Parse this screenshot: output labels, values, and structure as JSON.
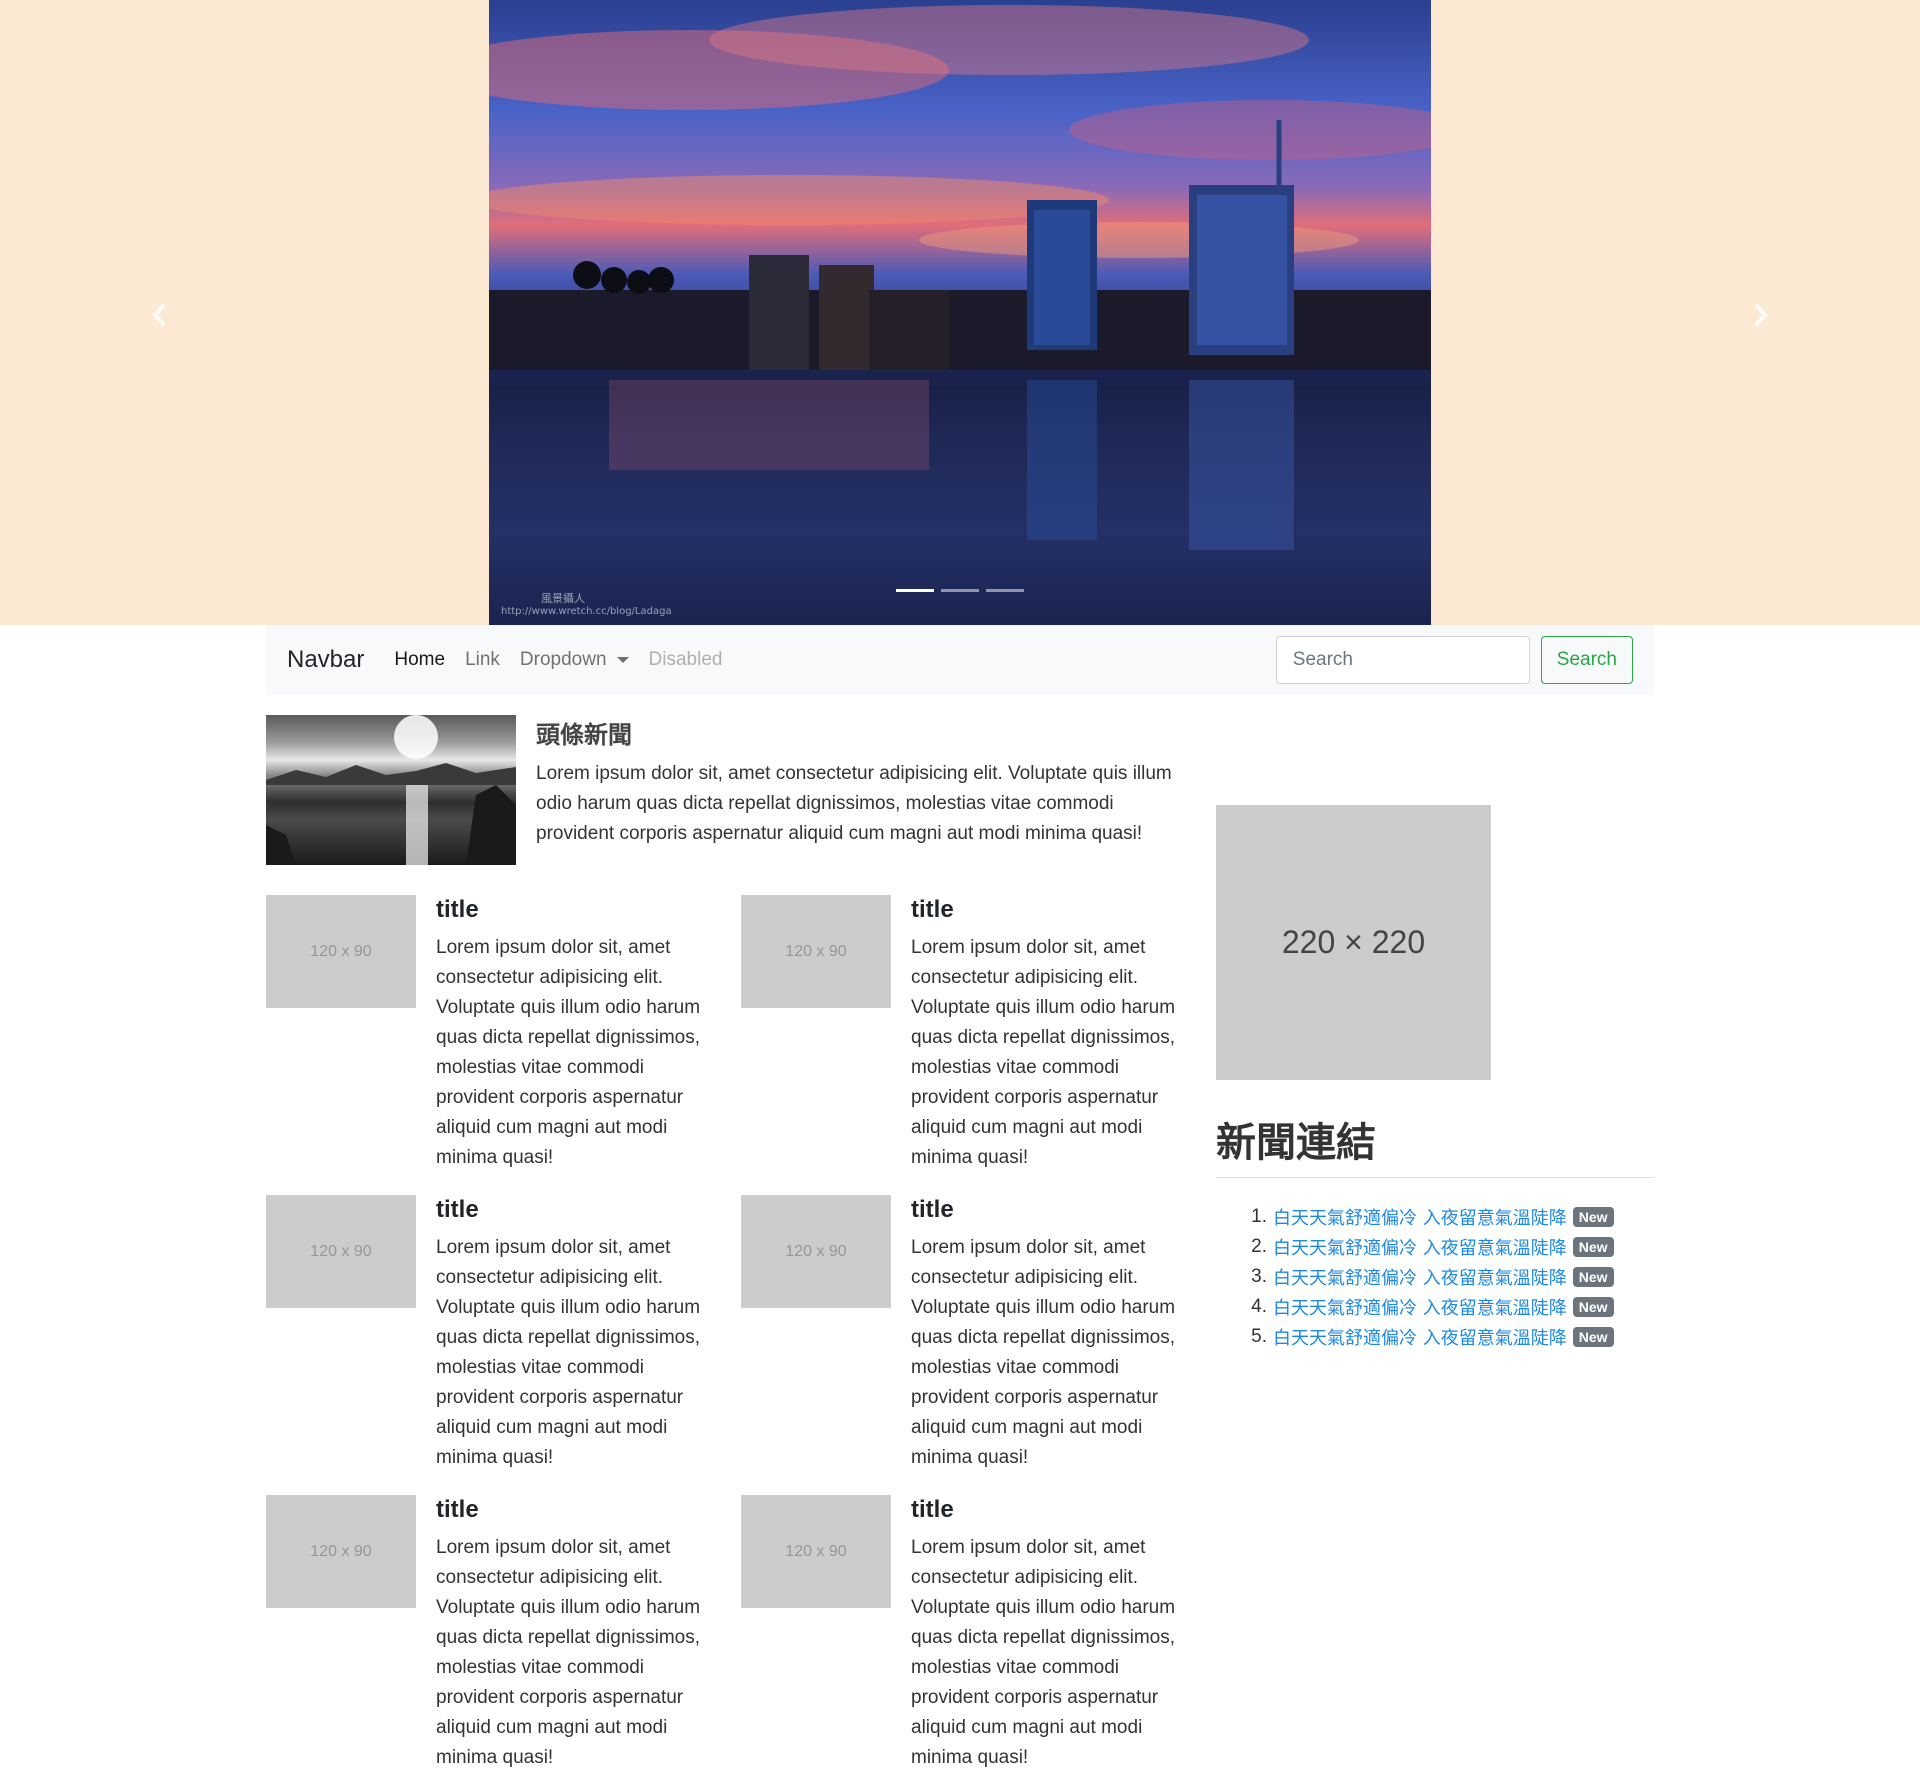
{
  "colors": {
    "carousel_bg": "#fbe9d3",
    "navbar_bg": "#f8f9fa",
    "success": "#28a745",
    "link": "#1e88e5",
    "placeholder_gray": "#cccccc",
    "badge_bg": "#6c757d"
  },
  "carousel": {
    "prev_icon": "chevron-left-icon",
    "next_icon": "chevron-right-icon",
    "slides": 3,
    "active_slide": 1,
    "watermark": "風景攝人",
    "watermark_url": "http://www.wretch.cc/blog/Ladaga"
  },
  "navbar": {
    "brand": "Navbar",
    "links": [
      {
        "label": "Home",
        "state": "active"
      },
      {
        "label": "Link",
        "state": "normal"
      },
      {
        "label": "Dropdown",
        "state": "dropdown"
      },
      {
        "label": "Disabled",
        "state": "disabled"
      }
    ],
    "search_placeholder": "Search",
    "search_button": "Search"
  },
  "headline": {
    "title": "頭條新聞",
    "text": "Lorem ipsum dolor sit, amet consectetur adipisicing elit. Voluptate quis illum odio harum quas dicta repellat dignissimos, molestias vitae commodi provident corporis aspernatur aliquid cum magni aut modi minima quasi!"
  },
  "media_items": [
    {
      "thumb": "120 x 90",
      "title": "title",
      "text": "Lorem ipsum dolor sit, amet consectetur adipisicing elit. Voluptate quis illum odio harum quas dicta repellat dignissimos, molestias vitae commodi provident corporis aspernatur aliquid cum magni aut modi minima quasi!"
    },
    {
      "thumb": "120 x 90",
      "title": "title",
      "text": "Lorem ipsum dolor sit, amet consectetur adipisicing elit. Voluptate quis illum odio harum quas dicta repellat dignissimos, molestias vitae commodi provident corporis aspernatur aliquid cum magni aut modi minima quasi!"
    },
    {
      "thumb": "120 x 90",
      "title": "title",
      "text": "Lorem ipsum dolor sit, amet consectetur adipisicing elit. Voluptate quis illum odio harum quas dicta repellat dignissimos, molestias vitae commodi provident corporis aspernatur aliquid cum magni aut modi minima quasi!"
    },
    {
      "thumb": "120 x 90",
      "title": "title",
      "text": "Lorem ipsum dolor sit, amet consectetur adipisicing elit. Voluptate quis illum odio harum quas dicta repellat dignissimos, molestias vitae commodi provident corporis aspernatur aliquid cum magni aut modi minima quasi!"
    },
    {
      "thumb": "120 x 90",
      "title": "title",
      "text": "Lorem ipsum dolor sit, amet consectetur adipisicing elit. Voluptate quis illum odio harum quas dicta repellat dignissimos, molestias vitae commodi provident corporis aspernatur aliquid cum magni aut modi minima quasi!"
    },
    {
      "thumb": "120 x 90",
      "title": "title",
      "text": "Lorem ipsum dolor sit, amet consectetur adipisicing elit. Voluptate quis illum odio harum quas dicta repellat dignissimos, molestias vitae commodi provident corporis aspernatur aliquid cum magni aut modi minima quasi!"
    }
  ],
  "sidebar": {
    "ad_label": "220 × 220",
    "title": "新聞連結",
    "news": [
      {
        "num": "1.",
        "text": "白天天氣舒適偏冷 入夜留意氣溫陡降",
        "badge": "New"
      },
      {
        "num": "2.",
        "text": "白天天氣舒適偏冷 入夜留意氣溫陡降",
        "badge": "New"
      },
      {
        "num": "3.",
        "text": "白天天氣舒適偏冷 入夜留意氣溫陡降",
        "badge": "New"
      },
      {
        "num": "4.",
        "text": "白天天氣舒適偏冷 入夜留意氣溫陡降",
        "badge": "New"
      },
      {
        "num": "5.",
        "text": "白天天氣舒適偏冷 入夜留意氣溫陡降",
        "badge": "New"
      }
    ]
  }
}
